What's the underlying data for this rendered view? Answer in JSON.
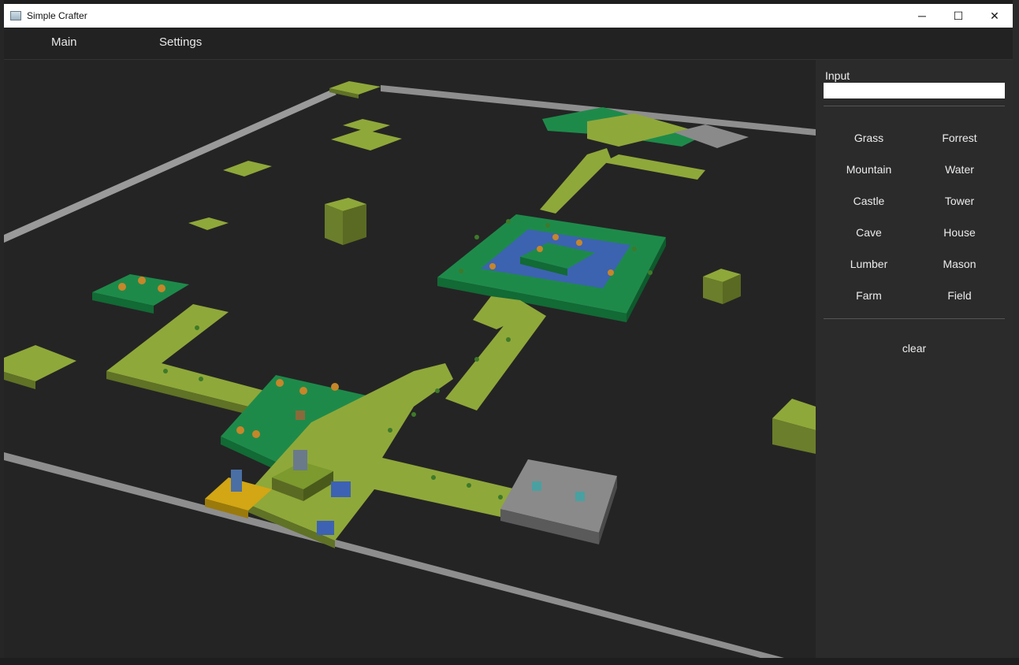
{
  "window": {
    "title": "Simple Crafter",
    "controls": {
      "minimize": "─",
      "maximize": "☐",
      "close": "✕"
    }
  },
  "menu": {
    "items": [
      {
        "label": "Main"
      },
      {
        "label": "Settings"
      }
    ]
  },
  "panel": {
    "input_label": "Input",
    "input_value": "",
    "tiles": [
      {
        "label": "Grass"
      },
      {
        "label": "Forrest"
      },
      {
        "label": "Mountain"
      },
      {
        "label": "Water"
      },
      {
        "label": "Castle"
      },
      {
        "label": "Tower"
      },
      {
        "label": "Cave"
      },
      {
        "label": "House"
      },
      {
        "label": "Lumber"
      },
      {
        "label": "Mason"
      },
      {
        "label": "Farm"
      },
      {
        "label": "Field"
      }
    ],
    "clear_label": "clear"
  },
  "colors": {
    "grass": "#8fa83a",
    "forest": "#1e8a4a",
    "water": "#3c63b0",
    "mountain": "#8a8a8a",
    "field": "#d2a614",
    "border": "#8e8e8e"
  }
}
